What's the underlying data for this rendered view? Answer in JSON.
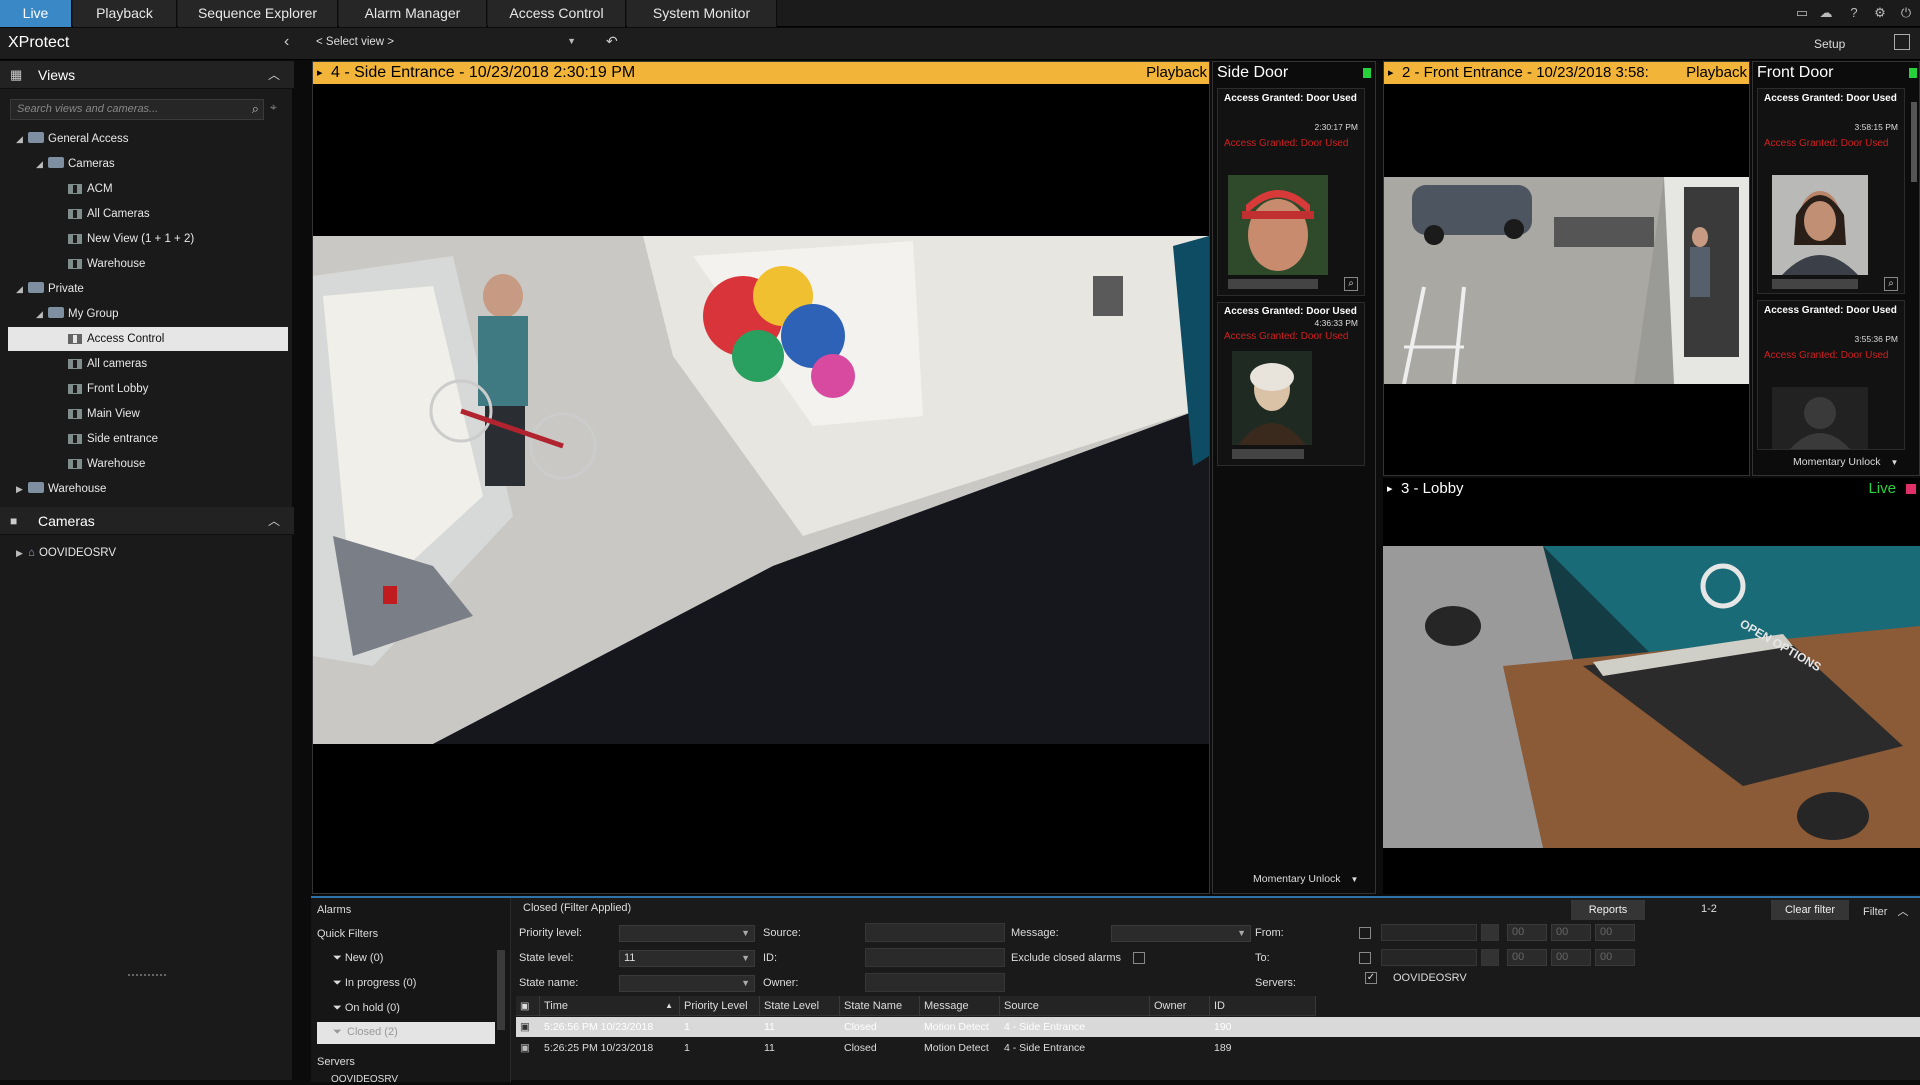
{
  "tabs": [
    {
      "label": "Live",
      "active": true
    },
    {
      "label": "Playback"
    },
    {
      "label": "Sequence Explorer"
    },
    {
      "label": "Alarm Manager"
    },
    {
      "label": "Access Control"
    },
    {
      "label": "System Monitor"
    }
  ],
  "app_title": "XProtect",
  "select_view": "< Select view >",
  "setup_label": "Setup",
  "views_panel": {
    "title": "Views",
    "search_placeholder": "Search views and cameras...",
    "tree": [
      {
        "label": "General Access"
      },
      {
        "label": "Cameras"
      },
      {
        "label": "ACM"
      },
      {
        "label": "All Cameras"
      },
      {
        "label": "New View (1 + 1 + 2)"
      },
      {
        "label": "Warehouse"
      },
      {
        "label": "Private"
      },
      {
        "label": "My Group"
      },
      {
        "label": "Access Control"
      },
      {
        "label": "All cameras"
      },
      {
        "label": "Front Lobby"
      },
      {
        "label": "Main View"
      },
      {
        "label": "Side entrance"
      },
      {
        "label": "Warehouse"
      },
      {
        "label": "Warehouse"
      }
    ]
  },
  "cameras_panel": {
    "title": "Cameras",
    "server": "OOVIDEOSRV"
  },
  "views": {
    "side_entrance": {
      "title": "4 - Side Entrance - 10/23/2018 2:30:19 PM",
      "mode": "Playback"
    },
    "side_door": {
      "title": "Side Door",
      "cards": [
        {
          "title": "Access Granted: Door Used",
          "time": "2:30:17 PM",
          "red": "Access Granted: Door Used"
        },
        {
          "title": "Access Granted: Door Used",
          "time": "4:36:33 PM",
          "red": "Access Granted: Door Used"
        }
      ],
      "unlock": "Momentary Unlock"
    },
    "front_entrance": {
      "title": "2 - Front Entrance - 10/23/2018 3:58:",
      "mode": "Playback"
    },
    "front_door": {
      "title": "Front Door",
      "cards": [
        {
          "title": "Access Granted: Door Used",
          "time": "3:58:15 PM",
          "red": "Access Granted: Door Used"
        },
        {
          "title": "Access Granted: Door Used",
          "time": "3:55:36 PM",
          "red": "Access Granted: Door Used"
        }
      ],
      "unlock": "Momentary Unlock"
    },
    "lobby": {
      "title": "3 - Lobby",
      "mode": "Live",
      "sign": "OPEN OPTIONS"
    }
  },
  "alarms": {
    "title": "Alarms",
    "status": "Closed (Filter Applied)",
    "quick_filters_label": "Quick Filters",
    "quick_filters": [
      "New (0)",
      "In progress (0)",
      "On hold (0)",
      "Closed (2)"
    ],
    "servers_label": "Servers",
    "server_item": "OOVIDEOSRV",
    "reports_label": "Reports",
    "page": "1-2",
    "clear_filter": "Clear filter",
    "filter": "Filter",
    "filters": {
      "priority_level": "Priority level:",
      "state_level": "State level:",
      "state_level_value": "11",
      "state_name": "State name:",
      "source": "Source:",
      "id": "ID:",
      "owner": "Owner:",
      "message": "Message:",
      "exclude": "Exclude closed alarms",
      "from": "From:",
      "to": "To:",
      "servers": "Servers:",
      "server_value": "OOVIDEOSRV",
      "time_zero": "00"
    },
    "columns": [
      "Time",
      "Priority Level",
      "State Level",
      "State Name",
      "Message",
      "Source",
      "Owner",
      "ID"
    ],
    "rows": [
      {
        "time": "5:26:56 PM 10/23/2018",
        "priority": "1",
        "state_level": "11",
        "state_name": "Closed",
        "message": "Motion Detect",
        "source": "4 - Side Entrance",
        "owner": "",
        "id": "190"
      },
      {
        "time": "5:26:25 PM 10/23/2018",
        "priority": "1",
        "state_level": "11",
        "state_name": "Closed",
        "message": "Motion Detect",
        "source": "4 - Side Entrance",
        "owner": "",
        "id": "189"
      }
    ]
  },
  "colors": {
    "accent": "#3b88c6",
    "playback": "#f2b53a",
    "live": "#27d13b",
    "alert_red": "#d02020"
  }
}
